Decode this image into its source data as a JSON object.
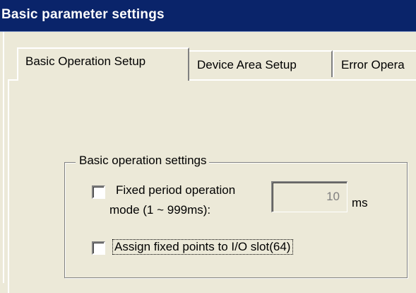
{
  "window": {
    "title": "Basic parameter settings"
  },
  "tabs": [
    {
      "label": "Basic Operation Setup",
      "selected": true
    },
    {
      "label": "Device Area Setup",
      "selected": false
    },
    {
      "label": "Error Opera",
      "selected": false
    }
  ],
  "basic_operation": {
    "group_title": "Basic operation settings",
    "fixed_period": {
      "checked": false,
      "label_line1": "Fixed period operation",
      "label_line2": "mode (1 ~ 999ms):",
      "value": "10",
      "unit": "ms"
    },
    "assign_fixed_points": {
      "checked": false,
      "label": "Assign fixed points to I/O slot(64)"
    }
  },
  "colors": {
    "title_bar": "#0a246a",
    "title_text": "#ffffff",
    "face": "#ece9d8",
    "disabled_text": "#808080"
  }
}
